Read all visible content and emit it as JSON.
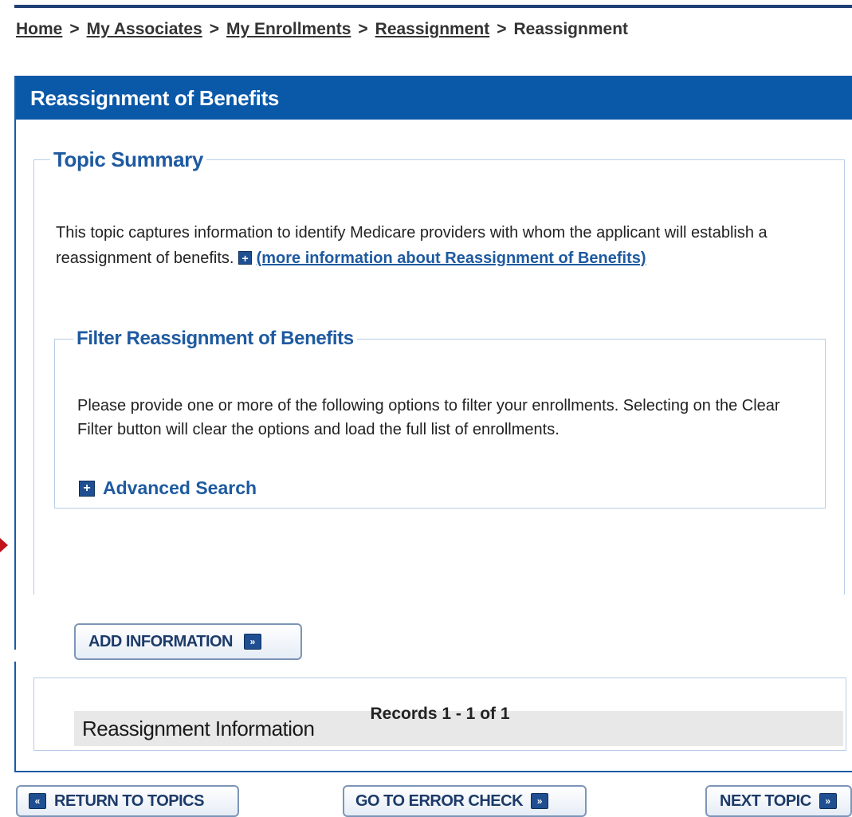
{
  "breadcrumb": {
    "items": [
      "Home",
      "My Associates",
      "My Enrollments",
      "Reassignment"
    ],
    "current": "Reassignment",
    "separator": ">"
  },
  "panel": {
    "title": "Reassignment of Benefits"
  },
  "topic_summary": {
    "legend": "Topic Summary",
    "text": "This topic captures information to identify Medicare providers with whom the applicant will establish a reassignment of benefits.",
    "more_info_link": "(more information about Reassignment of Benefits)",
    "expand_icon": "plus-icon"
  },
  "filter": {
    "legend": "Filter Reassignment of Benefits",
    "text": "Please provide one or more of the following options to filter your enrollments. Selecting on the Clear Filter button will clear the options and load the full list of enrollments.",
    "advanced_search": "Advanced Search"
  },
  "buttons": {
    "add_information": "ADD INFORMATION",
    "return_to_topics": "RETURN TO TOPICS",
    "go_to_error_check": "GO TO ERROR CHECK",
    "next_topic": "NEXT TOPIC"
  },
  "section": {
    "title": "Reassignment Information"
  },
  "records": {
    "text": "Records 1 - 1 of 1"
  },
  "colors": {
    "header_bg": "#0a58a8",
    "legend_text": "#1e5aa0",
    "border": "#b8cde6",
    "button_border": "#7c95b8",
    "icon_bg": "#1f4f91",
    "indicator_arrow": "#c0131a"
  }
}
